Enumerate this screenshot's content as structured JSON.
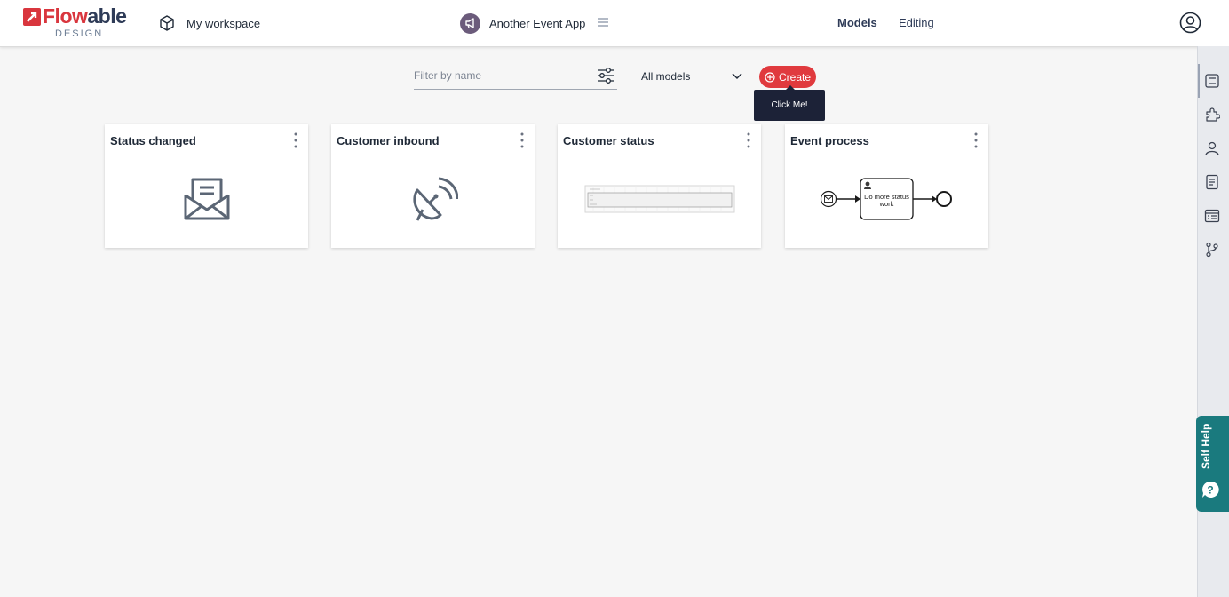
{
  "header": {
    "logo_text_flow": "Flow",
    "logo_text_able": "able",
    "logo_sub": "DESIGN",
    "workspace_label": "My workspace",
    "app_name": "Another Event App",
    "nav": [
      {
        "label": "Models",
        "active": true
      },
      {
        "label": "Editing",
        "active": false
      }
    ]
  },
  "toolbar": {
    "filter_placeholder": "Filter by name",
    "filter_value": "",
    "select_value": "All models",
    "create_label": "Create",
    "tooltip": "Click Me!"
  },
  "cards": [
    {
      "title": "Status changed",
      "icon": "envelope-open-icon"
    },
    {
      "title": "Customer inbound",
      "icon": "satellite-dish-icon"
    },
    {
      "title": "Customer status",
      "icon": "form-preview-thumbnail"
    },
    {
      "title": "Event process",
      "icon": "bpmn-diagram-thumbnail",
      "task_label": "Do more status work"
    }
  ],
  "rail": {
    "icons": [
      "app-settings-icon",
      "puzzle-icon",
      "user-icon",
      "document-icon",
      "list-icon",
      "git-branch-icon"
    ]
  },
  "help": {
    "label": "Self Help"
  },
  "colors": {
    "accent": "#e03a3e",
    "brand_dark": "#2e3b57",
    "help_bg": "#1a7a7e",
    "tooltip_bg": "#1c2237"
  }
}
